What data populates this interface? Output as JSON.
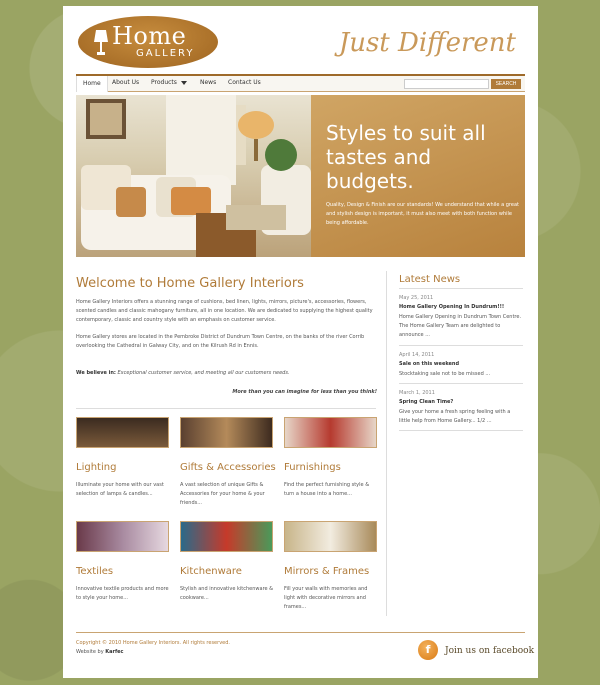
{
  "header": {
    "logo_home": "Home",
    "logo_gallery": "GALLERY",
    "tagline": "Just Different"
  },
  "nav": {
    "items": [
      "Home",
      "About Us",
      "Products",
      "News",
      "Contact Us"
    ],
    "active": "Home",
    "search_placeholder": "",
    "search_button": "SEARCH"
  },
  "hero": {
    "headline": "Styles to suit all tastes and budgets.",
    "caption": "Quality, Design & Finish are our standards! We understand that while a great and stylish design is important, it must also meet with both function while being affordable."
  },
  "welcome": {
    "title": "Welcome to Home Gallery Interiors",
    "p1": "Home Gallery Interiors offers a stunning range of cushions, bed linen, lights, mirrors, picture's, accessories, flowers, scented candles and classic mahogany furniture, all in one location. We are dedicated to supplying the highest quality contemporary, classic and country style with an emphasis on customer service.",
    "p2": "Home Gallery stores are located in the Pembroke District of Dundrum Town Centre, on the banks of the river Corrib overlooking the Cathedral in Galway City, and on the Kilrush Rd in Ennis.",
    "believe_label": "We believe in:",
    "believe_text": "Exceptional customer service, and meeting all our customers needs.",
    "slogan": "More than you can imagine for less than you think!"
  },
  "categories": [
    {
      "title": "Lighting",
      "desc": "Illuminate your home with our vast selection of lamps & candles..."
    },
    {
      "title": "Gifts & Accessories",
      "desc": "A vast selection of unique Gifts & Accessories for your home & your friends..."
    },
    {
      "title": "Furnishings",
      "desc": "Find the perfect furnishing style & turn a house into a home..."
    },
    {
      "title": "Textiles",
      "desc": "Innovative textile products and more to style your home..."
    },
    {
      "title": "Kitchenware",
      "desc": "Stylish and innovative kitchenware & cookware..."
    },
    {
      "title": "Mirrors & Frames",
      "desc": "Fill your walls with memories and light with decorative mirrors and frames..."
    }
  ],
  "news": {
    "title": "Latest News",
    "items": [
      {
        "date": "May 25, 2011",
        "head": "Home Gallery Opening In Dundrum!!!",
        "body": "Home Gallery Opening in Dundrum Town Centre. The Home Gallery Team are delighted to announce ..."
      },
      {
        "date": "April 14, 2011",
        "head": "Sale on this weekend",
        "body": "Stocktaking sale not to be missed ..."
      },
      {
        "date": "March 1, 2011",
        "head": "Spring Clean Time?",
        "body": "Give your home a fresh spring feeling with a little help from Home Gallery... 1/2 ..."
      }
    ]
  },
  "footer": {
    "copyright": "Copyright © 2010 Home Gallery Interiors. All rights reserved.",
    "website_label": "Website by",
    "website_name": "Karfec",
    "facebook": "Join us on facebook"
  },
  "colors": {
    "accent": "#b07b39",
    "background": "#9aa463"
  }
}
